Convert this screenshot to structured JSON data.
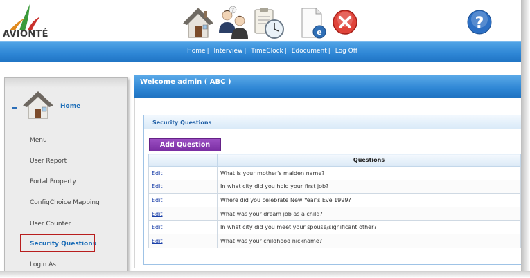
{
  "brand": {
    "name": "AVIONTÉ"
  },
  "toolbar": {
    "icons": [
      "home-icon",
      "interview-icon",
      "timeclock-icon",
      "edocument-icon",
      "logoff-icon",
      "help-icon"
    ]
  },
  "nav": {
    "items": [
      {
        "label": "Home",
        "sep": "|"
      },
      {
        "label": "Interview",
        "sep": "|"
      },
      {
        "label": "TimeClock",
        "sep": "|"
      },
      {
        "label": "Edocument",
        "sep": "|"
      },
      {
        "label": "Log Off",
        "sep": ""
      }
    ]
  },
  "sidebar": {
    "home_label": "Home",
    "items": [
      {
        "label": "Menu"
      },
      {
        "label": "User Report"
      },
      {
        "label": "Portal Property"
      },
      {
        "label": "ConfigChoice Mapping"
      },
      {
        "label": "User Counter"
      },
      {
        "label": "Security Questions"
      },
      {
        "label": "Login As"
      }
    ]
  },
  "main": {
    "welcome": "Welcome admin ( ABC )",
    "panel_title": "Security Questions",
    "add_button": "Add Question",
    "table": {
      "headers": [
        "",
        "Questions"
      ],
      "rows": [
        {
          "action": "Edit",
          "question": "What is your mother's maiden name?"
        },
        {
          "action": "Edit",
          "question": "In what city did you hold your first job?"
        },
        {
          "action": "Edit",
          "question": "Where did you celebrate New Year's Eve 1999?"
        },
        {
          "action": "Edit",
          "question": "What was your dream job as a child?"
        },
        {
          "action": "Edit",
          "question": "In what city did you meet your spouse/significant other?"
        },
        {
          "action": "Edit",
          "question": "What was your childhood nickname?"
        }
      ]
    }
  },
  "colors": {
    "nav_blue": "#2f87d6",
    "link_blue": "#1f6fb8",
    "button_purple": "#7a2ea3",
    "highlight_red": "#b81e1e"
  }
}
